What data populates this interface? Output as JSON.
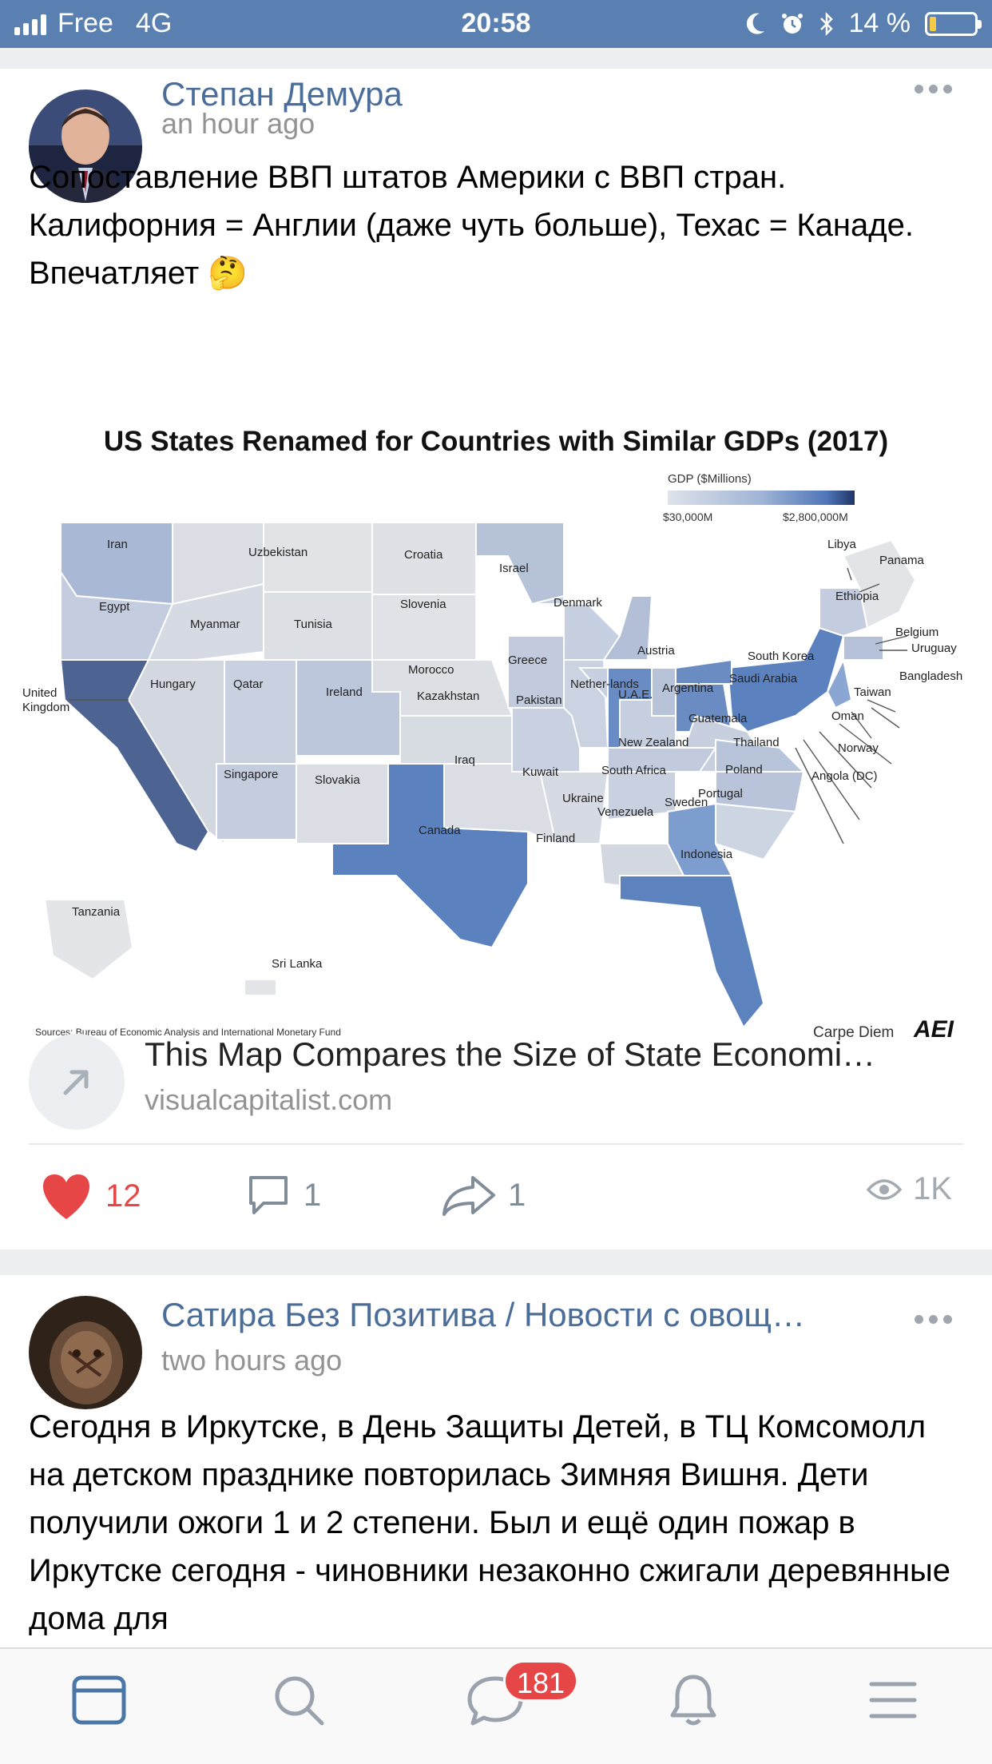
{
  "status_bar": {
    "carrier": "Free",
    "network": "4G",
    "time": "20:58",
    "battery": "14 %",
    "battery_level": 0.14,
    "colors": {
      "background": "#5a80b1",
      "battery_fill": "#f7c948"
    }
  },
  "posts": [
    {
      "author": "Степан Демура",
      "time": "an hour ago",
      "text": "Сопоставление ВВП штатов Америки с ВВП стран. Калифорния = Англии (даже чуть больше), Техас = Канаде. Впечатляет 🤔",
      "image": {
        "title": "US States Renamed for Countries with Similar GDPs (2017)",
        "legend_title": "GDP ($Millions)",
        "legend_min": "$30,000M",
        "legend_max": "$2,800,000M",
        "source": "Sources: Bureau of Economic Analysis and International Monetary Fund",
        "credit": "Carpe Diem",
        "logo": "AEI",
        "labels": {
          "iran": "Iran",
          "egypt": "Egypt",
          "uzbekistan": "Uzbekistan",
          "myanmar": "Myanmar",
          "tunisia": "Tunisia",
          "hungary": "Hungary",
          "qatar": "Qatar",
          "ireland": "Ireland",
          "singapore": "Singapore",
          "slovakia": "Slovakia",
          "croatia": "Croatia",
          "slovenia": "Slovenia",
          "morocco": "Morocco",
          "kazakhstan": "Kazakhstan",
          "iraq": "Iraq",
          "canada": "Canada",
          "israel": "Israel",
          "denmark": "Denmark",
          "greece": "Greece",
          "pakistan": "Pakistan",
          "kuwait": "Kuwait",
          "ukraine": "Ukraine",
          "finland": "Finland",
          "netherlands": "Nether-lands",
          "austria": "Austria",
          "uae": "U.A.E.",
          "argentina": "Argentina",
          "south_korea": "South Korea",
          "saudi_arabia": "Saudi Arabia",
          "new_zealand": "New Zealand",
          "south_africa": "South Africa",
          "venezuela": "Venezuela",
          "guatemala": "Guatemala",
          "thailand": "Thailand",
          "poland": "Poland",
          "portugal": "Portugal",
          "sweden": "Sweden",
          "indonesia": "Indonesia",
          "libya": "Libya",
          "panama": "Panama",
          "ethiopia": "Ethiopia",
          "belgium": "Belgium",
          "uruguay": "Uruguay",
          "bangladesh": "Bangladesh",
          "taiwan": "Taiwan",
          "oman": "Oman",
          "norway": "Norway",
          "angola": "Angola (DC)",
          "united_kingdom": "United Kingdom",
          "tanzania": "Tanzania",
          "sri_lanka": "Sri Lanka"
        }
      },
      "link": {
        "title": "This Map Compares the Size of State Economi…",
        "domain": "visualcapitalist.com"
      },
      "likes": "12",
      "comments": "1",
      "shares": "1",
      "views": "1K"
    },
    {
      "author": "Сатира Без Позитива / Новости с овощ…",
      "time": "two hours ago",
      "text": "Сегодня в Иркутске, в День Защиты Детей, в ТЦ Комсомолл на детском празднике повторилась Зимняя Вишня. Дети получили ожоги 1 и 2 степени. Был и ещё один пожар в Иркутске сегодня - чиновники незаконно сжигали деревянные дома для"
    }
  ],
  "tab_bar": {
    "items": [
      "news-icon",
      "search-icon",
      "messages-icon",
      "notifications-icon",
      "menu-icon"
    ],
    "messages_badge": "181"
  }
}
